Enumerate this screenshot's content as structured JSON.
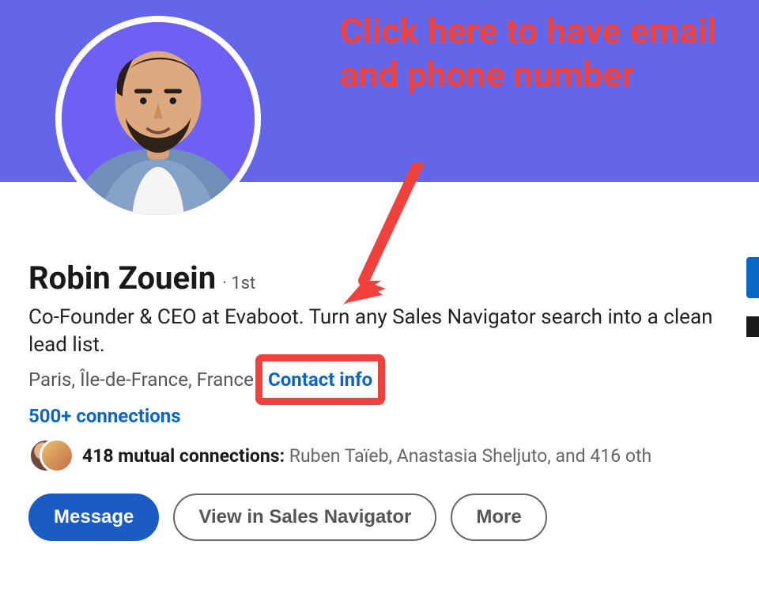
{
  "annotation": {
    "text": "Click here to have email and phone number",
    "highlight_color": "#f0413c"
  },
  "banner": {
    "color": "#6366e8"
  },
  "profile": {
    "name": "Robin Zouein",
    "degree": "· 1st",
    "headline": "Co-Founder & CEO at Evaboot. Turn any Sales Navigator search into a clean lead list.",
    "location": "Paris, Île-de-France, France",
    "contact_info_label": "Contact info",
    "connections_label": "500+ connections",
    "mutual": {
      "count_label": "418 mutual connections:",
      "names": "Ruben Taïeb, Anastasia Sheljuto, and 416 oth"
    }
  },
  "actions": {
    "message": "Message",
    "view_sales_nav": "View in Sales Navigator",
    "more": "More"
  },
  "colors": {
    "link": "#0a66c2",
    "primary_btn": "#1a5cc2",
    "annotation": "#f0413c"
  }
}
